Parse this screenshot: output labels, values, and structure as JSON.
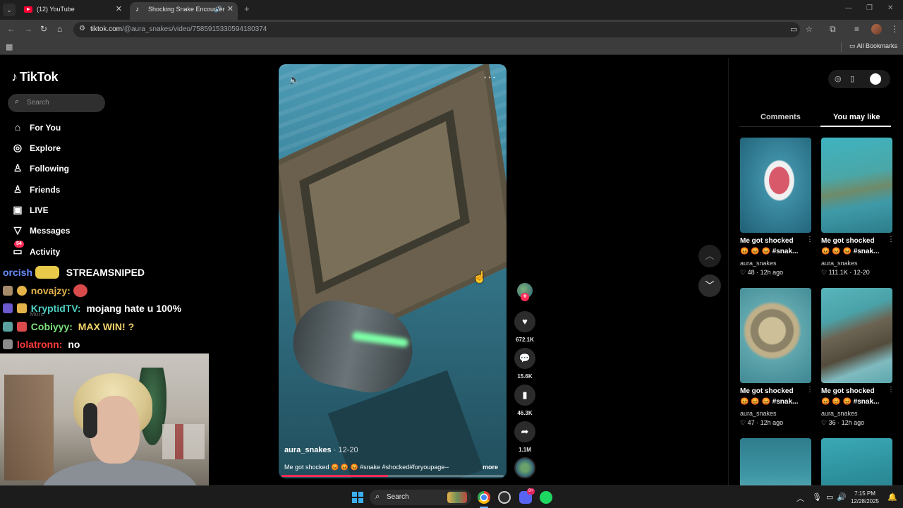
{
  "browser": {
    "tabs": [
      {
        "title": "(12) YouTube",
        "active": false,
        "favicon": "youtube-icon"
      },
      {
        "title": "Shocking Snake Encounter",
        "active": true,
        "favicon": "tiktok-icon"
      }
    ],
    "address": {
      "host": "tiktok.com",
      "path": "/@aura_snakes/video/7585915330594180374"
    },
    "bookmarks": {
      "all_bookmarks_label": "All Bookmarks"
    }
  },
  "tiktok": {
    "brand": "TikTok",
    "search_placeholder": "Search",
    "nav": [
      {
        "label": "For You",
        "icon": "home-icon"
      },
      {
        "label": "Explore",
        "icon": "compass-icon"
      },
      {
        "label": "Following",
        "icon": "following-icon"
      },
      {
        "label": "Friends",
        "icon": "friends-icon"
      },
      {
        "label": "LIVE",
        "icon": "live-icon"
      },
      {
        "label": "Messages",
        "icon": "messages-icon"
      },
      {
        "label": "Activity",
        "icon": "activity-icon",
        "badge": "54"
      }
    ],
    "faded_labels": [
      "More"
    ],
    "video": {
      "author": "aura_snakes",
      "date": "· 12-20",
      "caption": "Me got shocked 😡 😡 😡 #snake #shocked#foryoupage--",
      "more_label": "more",
      "progress": 0.48,
      "actions": {
        "likes": "672.1K",
        "comments": "15.6K",
        "saves": "46.3K",
        "shares": "1.1M"
      }
    },
    "side_panel": {
      "tabs": [
        "Comments",
        "You may like"
      ],
      "active_tab": "You may like",
      "cards": [
        {
          "title": "Me got shocked",
          "subtitle": "😡 😡 😡 #snak...",
          "author": "aura_snakes",
          "likes": "48",
          "age": "12h ago"
        },
        {
          "title": "Me got shocked",
          "subtitle": "😡 😡 😡 #snak...",
          "author": "aura_snakes",
          "likes": "111.1K",
          "age": "12-20"
        },
        {
          "title": "Me got shocked",
          "subtitle": "😡 😡 😡 #snak...",
          "author": "aura_snakes",
          "likes": "47",
          "age": "12h ago"
        },
        {
          "title": "Me got shocked",
          "subtitle": "😡 😡 😡 #snak...",
          "author": "aura_snakes",
          "likes": "36",
          "age": "12h ago"
        },
        {
          "title": "",
          "subtitle": "",
          "author": "",
          "likes": "",
          "age": ""
        },
        {
          "title": "",
          "subtitle": "",
          "author": "",
          "likes": "",
          "age": ""
        }
      ]
    }
  },
  "stream_chat": [
    {
      "user": "orcish",
      "user_color": "#6b8cff",
      "message": "STREAMSNIPED"
    },
    {
      "user": "novajzy:",
      "user_color": "#e3b34a",
      "message": ""
    },
    {
      "user": "KryptidTV:",
      "user_color": "#4fd1c5",
      "message": "mojang hate u 100%"
    },
    {
      "user": "Cobiyyy:",
      "user_color": "#7be07b",
      "message": "MAX WIN! ?"
    },
    {
      "user": "lolatronn:",
      "user_color": "#ff3b3b",
      "message": "no"
    }
  ],
  "taskbar": {
    "search_label": "Search",
    "discord_badge": "9+",
    "time": "7:15 PM",
    "date": "12/28/2025"
  },
  "colors": {
    "tiktok_accent": "#fe2c55",
    "background": "#000000"
  }
}
